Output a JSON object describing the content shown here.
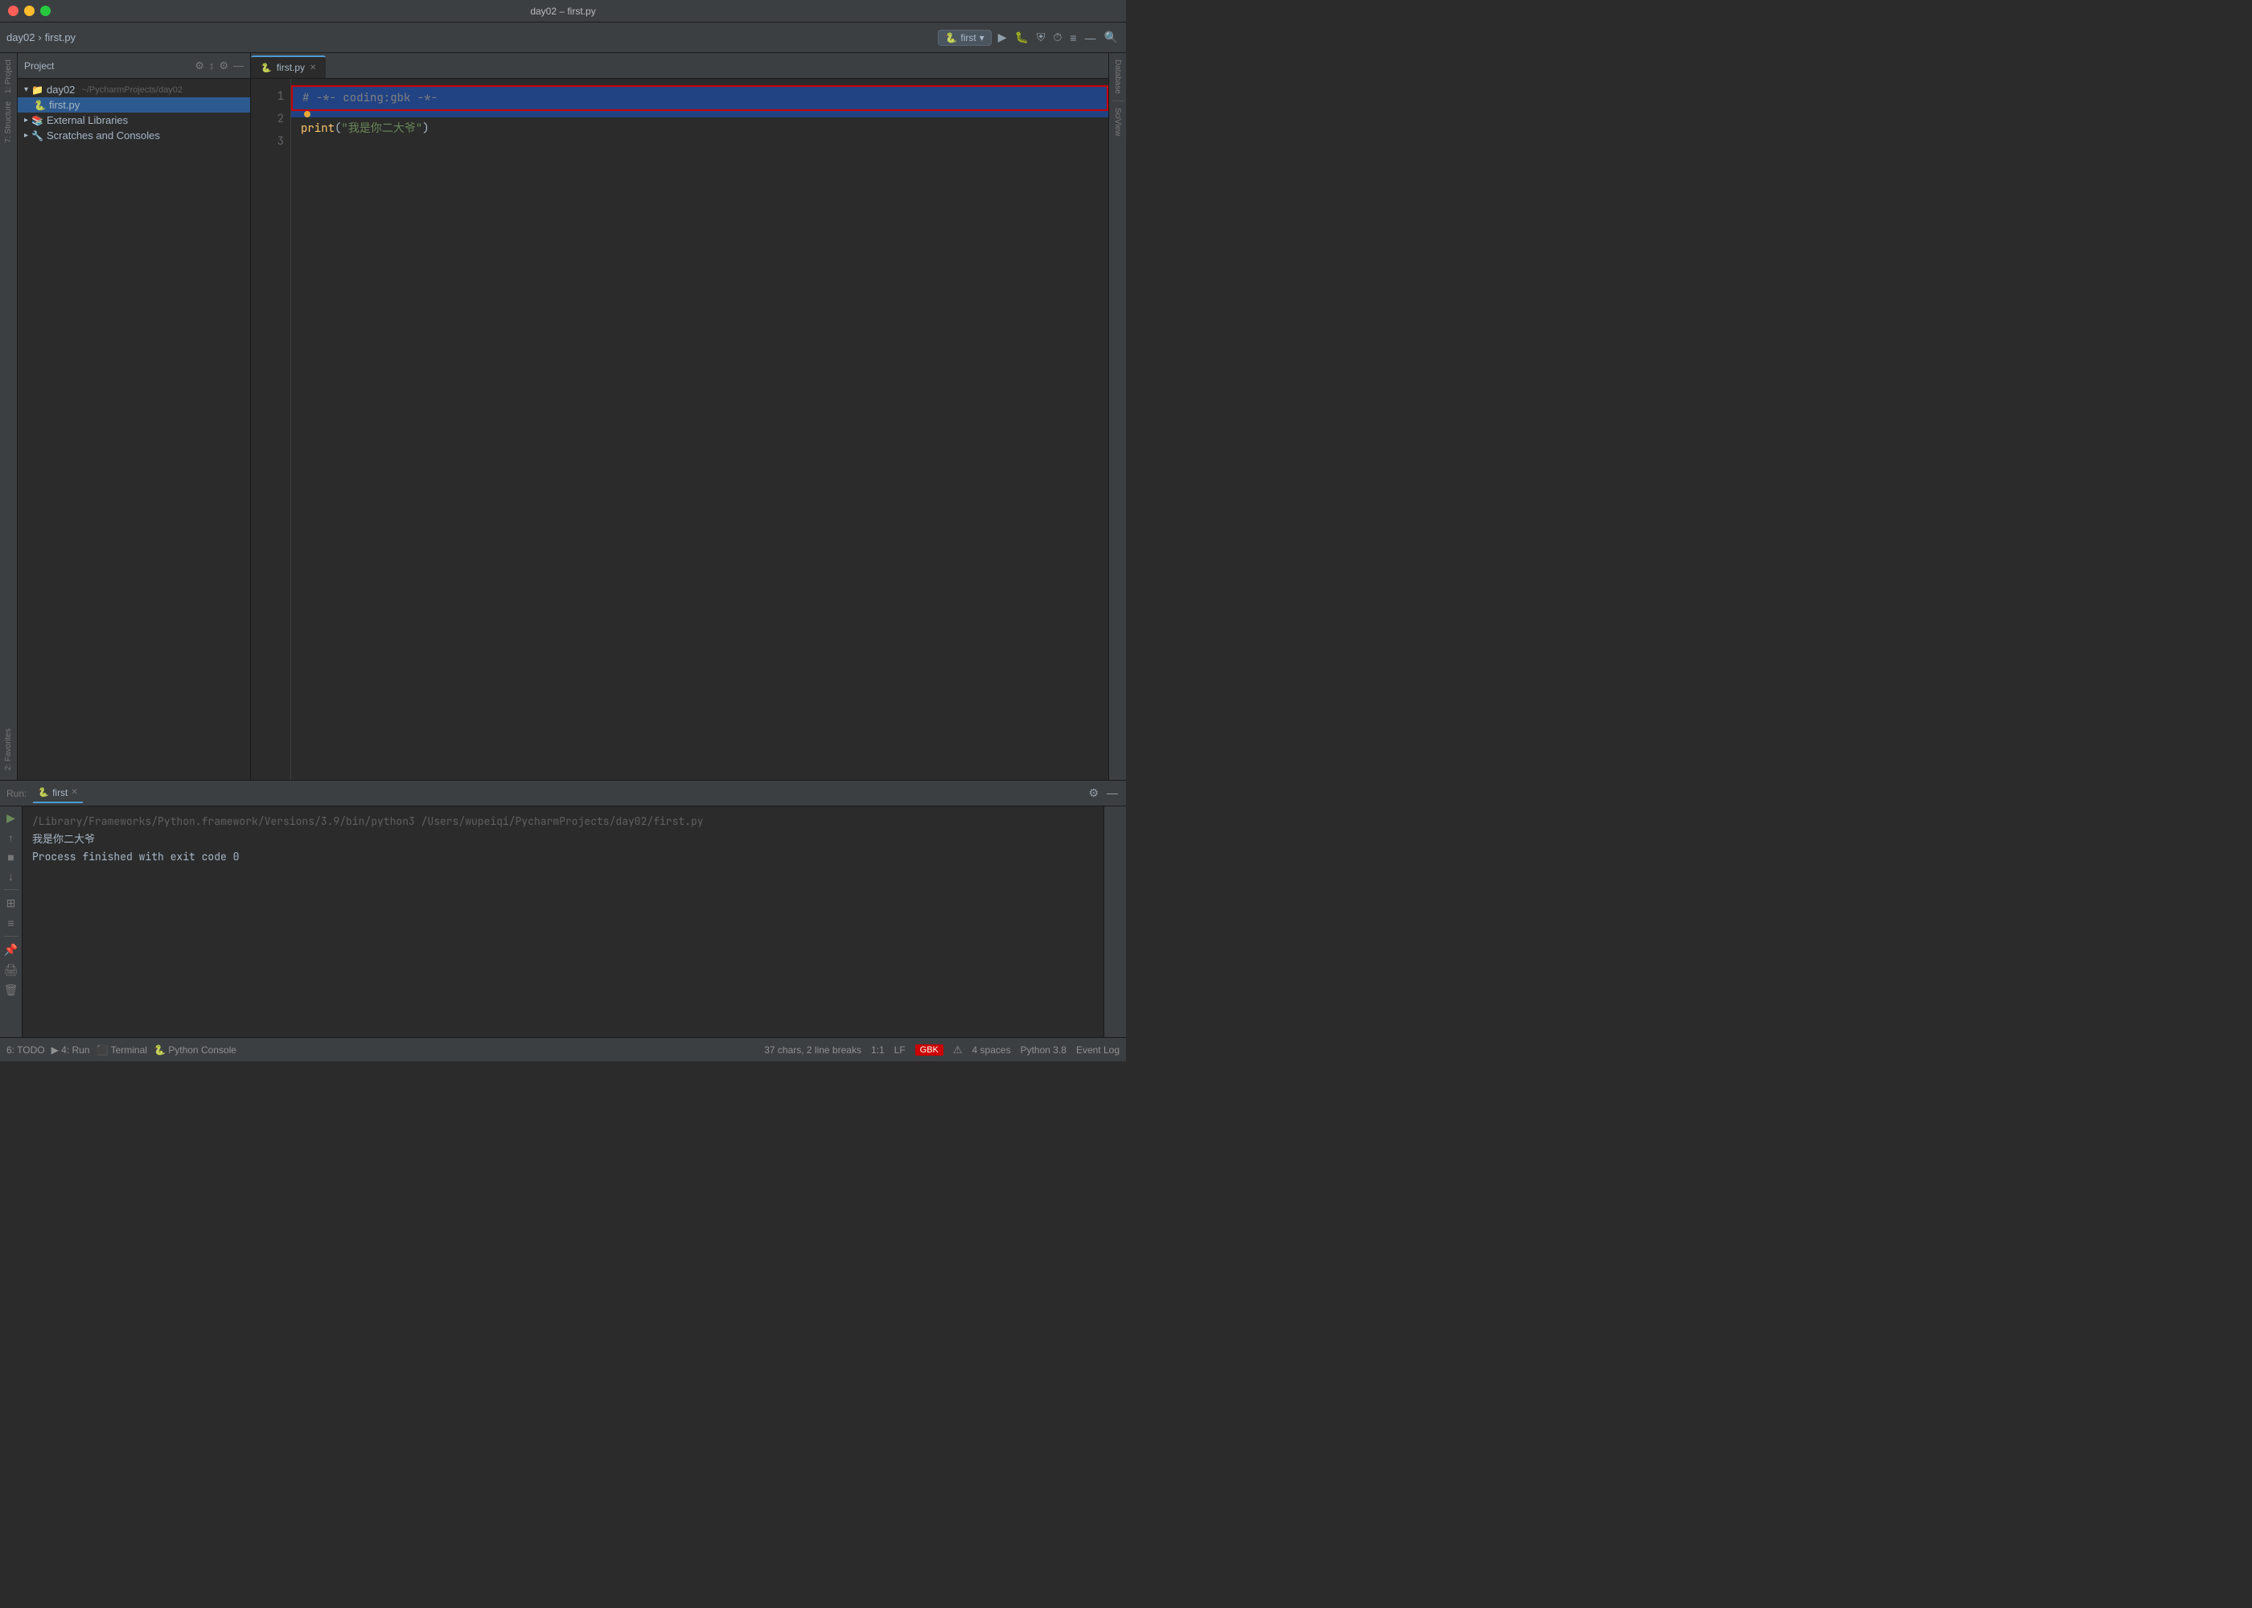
{
  "titlebar": {
    "title": "day02 – first.py"
  },
  "toolbar": {
    "breadcrumb_project": "day02",
    "breadcrumb_file": "first.py",
    "run_config": "first",
    "icons": [
      "⚙",
      "↕",
      "⚙",
      "—"
    ]
  },
  "project_panel": {
    "title": "Project",
    "tree": [
      {
        "label": "day02",
        "indent": 0,
        "type": "folder",
        "path": "~/PycharmProjects/day02"
      },
      {
        "label": "first.py",
        "indent": 1,
        "type": "file",
        "selected": true
      },
      {
        "label": "External Libraries",
        "indent": 0,
        "type": "library"
      },
      {
        "label": "Scratches and Consoles",
        "indent": 0,
        "type": "special"
      }
    ]
  },
  "editor": {
    "tab_label": "first.py",
    "lines": [
      {
        "num": 1,
        "content": "# -*- coding:gbk -*-",
        "type": "comment",
        "highlighted": true
      },
      {
        "num": 2,
        "content": "",
        "highlighted_bg": true
      },
      {
        "num": 3,
        "content": "print(\"我是你二大爷\")",
        "type": "code"
      }
    ]
  },
  "run_panel": {
    "label": "Run:",
    "tab_label": "first",
    "output_lines": [
      "/Library/Frameworks/Python.framework/Versions/3.9/bin/python3 /Users/wupeiqi/PycharmProjects/day02/first.py",
      "我是你二大爷",
      "",
      "Process finished with exit code 0"
    ]
  },
  "status_bar": {
    "todo": "6: TODO",
    "run": "4: Run",
    "terminal": "Terminal",
    "python_console": "Python Console",
    "right": {
      "stats": "37 chars, 2 line breaks",
      "position": "1:1",
      "line_sep": "LF",
      "encoding": "GBK",
      "indent": "4 spaces",
      "python_ver": "Python 3.8"
    },
    "event_log": "Event Log"
  },
  "right_strip": {
    "labels": [
      "Database",
      "SciView"
    ]
  }
}
